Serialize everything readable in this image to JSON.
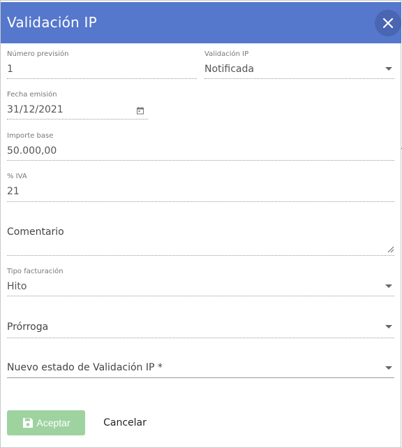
{
  "dialog": {
    "title": "Validación IP",
    "close_icon": "close-icon"
  },
  "form": {
    "numero_prevision": {
      "label": "Número previsión",
      "value": "1"
    },
    "validacion_ip": {
      "label": "Validación IP",
      "value": "Notificada",
      "icon": "chevron-down-icon"
    },
    "fecha_emision": {
      "label": "Fecha emisión",
      "value": "31/12/2021",
      "icon": "calendar-icon"
    },
    "importe_base": {
      "label": "Importe base",
      "value": "50.000,00"
    },
    "iva": {
      "label": "% IVA",
      "value": "21"
    },
    "comentario": {
      "label": "Comentario",
      "value": ""
    },
    "tipo_facturacion": {
      "label": "Tipo facturación",
      "value": "Hito"
    },
    "prorroga": {
      "label": "Prórroga",
      "value": ""
    },
    "nuevo_estado": {
      "label": "Nuevo estado de Validación IP *",
      "value": ""
    }
  },
  "actions": {
    "accept_label": "Aceptar",
    "accept_icon": "save-icon",
    "cancel_label": "Cancelar"
  },
  "colors": {
    "header": "#5577cc",
    "close_bg": "#4a65b2",
    "accept_bg": "#9ed3a0"
  }
}
